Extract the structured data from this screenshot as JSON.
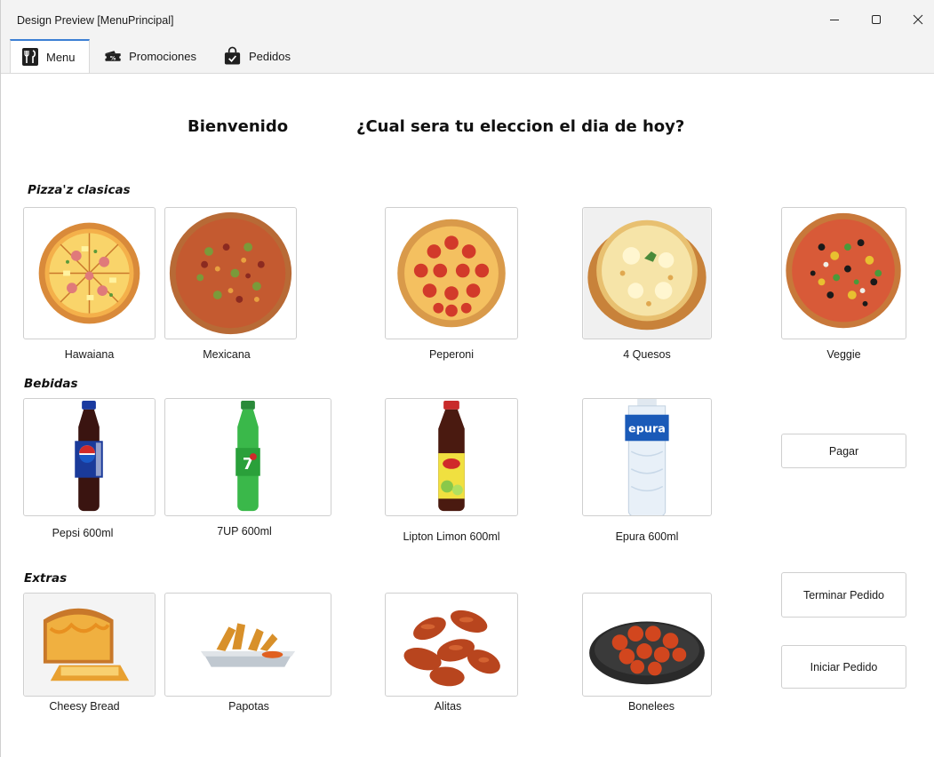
{
  "window": {
    "title": "Design Preview [MenuPrincipal]"
  },
  "tabs": [
    {
      "label": "Menu",
      "icon": "utensils-icon",
      "active": true
    },
    {
      "label": "Promociones",
      "icon": "discount-ticket-icon",
      "active": false
    },
    {
      "label": "Pedidos",
      "icon": "shopping-bag-icon",
      "active": false
    }
  ],
  "header": {
    "welcome": "Bienvenido",
    "question": "¿Cual sera tu eleccion el dia de hoy?"
  },
  "sections": {
    "pizzas": {
      "title": "Pizza'z clasicas",
      "items": [
        {
          "name": "Hawaiana",
          "image": "pizza-hawaiana"
        },
        {
          "name": "Mexicana",
          "image": "pizza-mexicana"
        },
        {
          "name": "Peperoni",
          "image": "pizza-peperoni"
        },
        {
          "name": "4 Quesos",
          "image": "pizza-4-quesos"
        },
        {
          "name": "Veggie",
          "image": "pizza-veggie"
        }
      ]
    },
    "bebidas": {
      "title": "Bebidas",
      "items": [
        {
          "name": "Pepsi 600ml",
          "image": "pepsi-bottle"
        },
        {
          "name": "7UP 600ml",
          "image": "7up-bottle"
        },
        {
          "name": "Lipton Limon 600ml",
          "image": "lipton-bottle"
        },
        {
          "name": "Epura 600ml",
          "image": "epura-bottle"
        }
      ]
    },
    "extras": {
      "title": "Extras",
      "items": [
        {
          "name": "Cheesy Bread",
          "image": "cheesy-bread"
        },
        {
          "name": "Papotas",
          "image": "papotas"
        },
        {
          "name": "Alitas",
          "image": "alitas"
        },
        {
          "name": "Bonelees",
          "image": "bonelees"
        }
      ]
    }
  },
  "actions": {
    "pagar": "Pagar",
    "terminar": "Terminar Pedido",
    "iniciar": "Iniciar Pedido"
  },
  "colors": {
    "tab_accent": "#3c7fd4",
    "titlebar_bg": "#f3f3f3",
    "border": "#cfcfcf"
  }
}
